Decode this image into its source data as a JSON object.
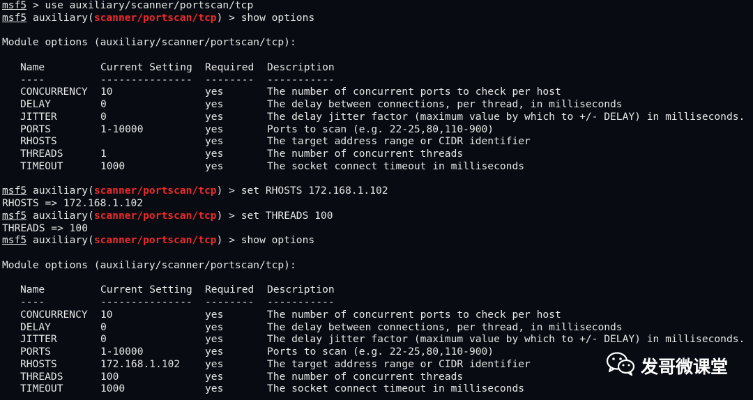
{
  "prompt_name": "msf5",
  "module_prefix": "auxiliary",
  "module_path": "scanner/portscan/tcp",
  "lines": {
    "l1_cmd": " > use auxiliary/scanner/portscan/tcp",
    "l2_cmd": ") > show options",
    "set_rhosts_cmd": ") > set RHOSTS 172.168.1.102",
    "set_rhosts_out": "RHOSTS => 172.168.1.102",
    "set_threads_cmd": ") > set THREADS 100",
    "set_threads_out": "THREADS => 100",
    "show_options_cmd": ") > show options"
  },
  "table_title": "Module options (auxiliary/scanner/portscan/tcp):",
  "headers": {
    "name": "Name",
    "setting": "Current Setting",
    "required": "Required",
    "description": "Description"
  },
  "separators": {
    "name": "----",
    "setting": "---------------",
    "required": "--------",
    "description": "-----------"
  },
  "table1": [
    {
      "name": "CONCURRENCY",
      "setting": "10",
      "required": "yes",
      "description": "The number of concurrent ports to check per host"
    },
    {
      "name": "DELAY",
      "setting": "0",
      "required": "yes",
      "description": "The delay between connections, per thread, in milliseconds"
    },
    {
      "name": "JITTER",
      "setting": "0",
      "required": "yes",
      "description": "The delay jitter factor (maximum value by which to +/- DELAY) in milliseconds."
    },
    {
      "name": "PORTS",
      "setting": "1-10000",
      "required": "yes",
      "description": "Ports to scan (e.g. 22-25,80,110-900)"
    },
    {
      "name": "RHOSTS",
      "setting": "",
      "required": "yes",
      "description": "The target address range or CIDR identifier"
    },
    {
      "name": "THREADS",
      "setting": "1",
      "required": "yes",
      "description": "The number of concurrent threads"
    },
    {
      "name": "TIMEOUT",
      "setting": "1000",
      "required": "yes",
      "description": "The socket connect timeout in milliseconds"
    }
  ],
  "table2": [
    {
      "name": "CONCURRENCY",
      "setting": "10",
      "required": "yes",
      "description": "The number of concurrent ports to check per host"
    },
    {
      "name": "DELAY",
      "setting": "0",
      "required": "yes",
      "description": "The delay between connections, per thread, in milliseconds"
    },
    {
      "name": "JITTER",
      "setting": "0",
      "required": "yes",
      "description": "The delay jitter factor (maximum value by which to +/- DELAY) in milliseconds."
    },
    {
      "name": "PORTS",
      "setting": "1-10000",
      "required": "yes",
      "description": "Ports to scan (e.g. 22-25,80,110-900)"
    },
    {
      "name": "RHOSTS",
      "setting": "172.168.1.102",
      "required": "yes",
      "description": "The target address range or CIDR identifier"
    },
    {
      "name": "THREADS",
      "setting": "100",
      "required": "yes",
      "description": "The number of concurrent threads"
    },
    {
      "name": "TIMEOUT",
      "setting": "1000",
      "required": "yes",
      "description": "The socket connect timeout in milliseconds"
    }
  ],
  "watermark": {
    "icon": "wechat-icon",
    "text": "发哥微课堂"
  },
  "colors": {
    "background": "#080c12",
    "text": "#e6e6e6",
    "module_highlight": "#ef2929"
  }
}
